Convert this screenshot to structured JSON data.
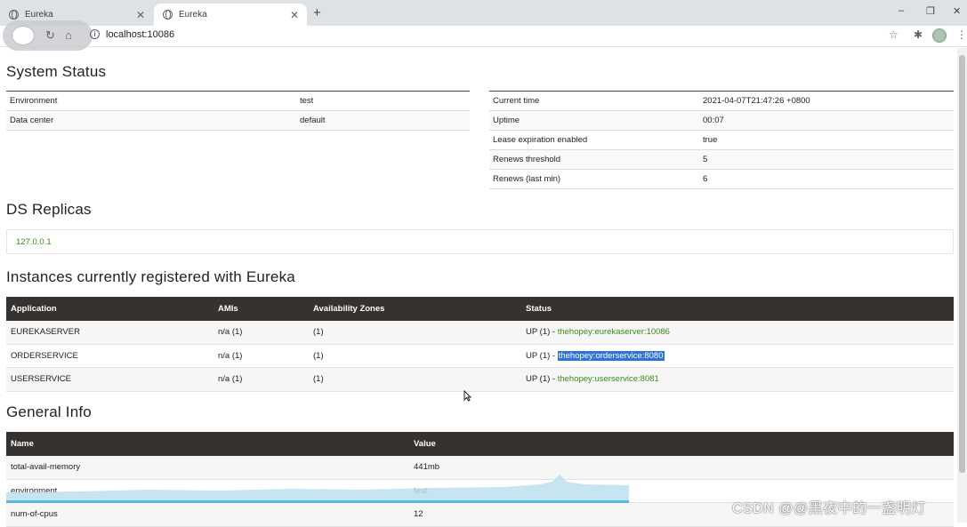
{
  "browser": {
    "tabs": [
      {
        "title": "Eureka",
        "active": false
      },
      {
        "title": "Eureka",
        "active": true
      }
    ],
    "url": "localhost:10086"
  },
  "system_status": {
    "heading": "System Status",
    "left": [
      {
        "key": "Environment",
        "value": "test"
      },
      {
        "key": "Data center",
        "value": "default"
      }
    ],
    "right": [
      {
        "key": "Current time",
        "value": "2021-04-07T21:47:26 +0800"
      },
      {
        "key": "Uptime",
        "value": "00:07"
      },
      {
        "key": "Lease expiration enabled",
        "value": "true"
      },
      {
        "key": "Renews threshold",
        "value": "5"
      },
      {
        "key": "Renews (last min)",
        "value": "6"
      }
    ]
  },
  "replicas": {
    "heading": "DS Replicas",
    "items": [
      "127.0.0.1"
    ]
  },
  "instances": {
    "heading": "Instances currently registered with Eureka",
    "columns": [
      "Application",
      "AMIs",
      "Availability Zones",
      "Status"
    ],
    "rows": [
      {
        "application": "EUREKASERVER",
        "amis": "n/a (1)",
        "zones": "(1)",
        "status": "UP (1) - ",
        "link": "thehopey:eurekaserver:10086"
      },
      {
        "application": "ORDERSERVICE",
        "amis": "n/a (1)",
        "zones": "(1)",
        "status": "UP (1) - ",
        "link": "thehopey:orderservice:8080"
      },
      {
        "application": "USERSERVICE",
        "amis": "n/a (1)",
        "zones": "(1)",
        "status": "UP (1) - ",
        "link": "thehopey:userservice:8081"
      }
    ]
  },
  "general_info": {
    "heading": "General Info",
    "columns": [
      "Name",
      "Value"
    ],
    "rows": [
      {
        "name": "total-avail-memory",
        "value": "441mb"
      },
      {
        "name": "environment",
        "value": "test"
      },
      {
        "name": "num-of-cpus",
        "value": "12"
      }
    ]
  },
  "watermark": "CSDN @@黑夜中的一盏明灯",
  "colors": {
    "link": "#3f8b1e",
    "table_header": "#353230",
    "selection": "#2e73d6"
  }
}
